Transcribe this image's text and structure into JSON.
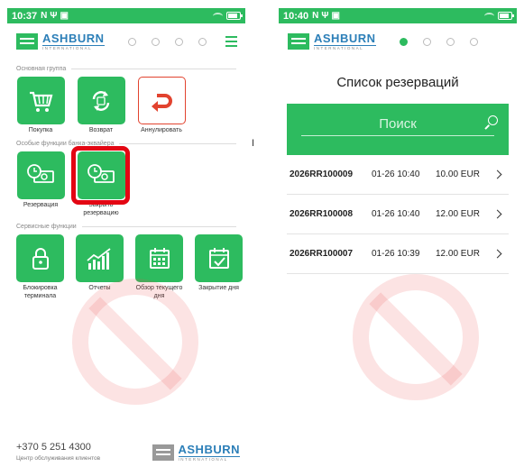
{
  "left": {
    "status": {
      "time": "10:37"
    },
    "logo": {
      "name": "ASHBURN",
      "sub": "INTERNATIONAL"
    },
    "sections": [
      {
        "title": "Основная группа",
        "tiles": [
          {
            "label": "Покупка",
            "icon": "cart-icon"
          },
          {
            "label": "Возврат",
            "icon": "refresh-icon"
          },
          {
            "label": "Аннулировать",
            "icon": "undo-icon"
          }
        ]
      },
      {
        "title": "Особые функции банка-эквайера",
        "tiles": [
          {
            "label": "Резервация",
            "icon": "money-clock-icon"
          },
          {
            "label": "Закрыть резервацию",
            "icon": "money-clock-icon"
          }
        ]
      },
      {
        "title": "Сервисные функции",
        "tiles": [
          {
            "label": "Блокировка терминала",
            "icon": "lock-icon"
          },
          {
            "label": "Отчеты",
            "icon": "chart-icon"
          },
          {
            "label": "Обзор текущего дня",
            "icon": "calendar-icon"
          },
          {
            "label": "Закрытие дня",
            "icon": "calendar-check-icon"
          }
        ]
      }
    ],
    "footer": {
      "phone": "+370 5 251 4300",
      "subtitle": "Центр обслуживания клиентов"
    }
  },
  "right": {
    "status": {
      "time": "10:40"
    },
    "title": "Список резерваций",
    "search": {
      "placeholder": "Поиск"
    },
    "reservations": [
      {
        "id": "2026RR100009",
        "date": "01-26 10:40",
        "amount": "10.00 EUR"
      },
      {
        "id": "2026RR100008",
        "date": "01-26 10:40",
        "amount": "12.00 EUR"
      },
      {
        "id": "2026RR100007",
        "date": "01-26 10:39",
        "amount": "12.00 EUR"
      }
    ]
  },
  "colors": {
    "accent": "#2dbb5f",
    "highlight": "#e30613",
    "cancel": "#e2432f",
    "brand": "#2c7fb8"
  }
}
